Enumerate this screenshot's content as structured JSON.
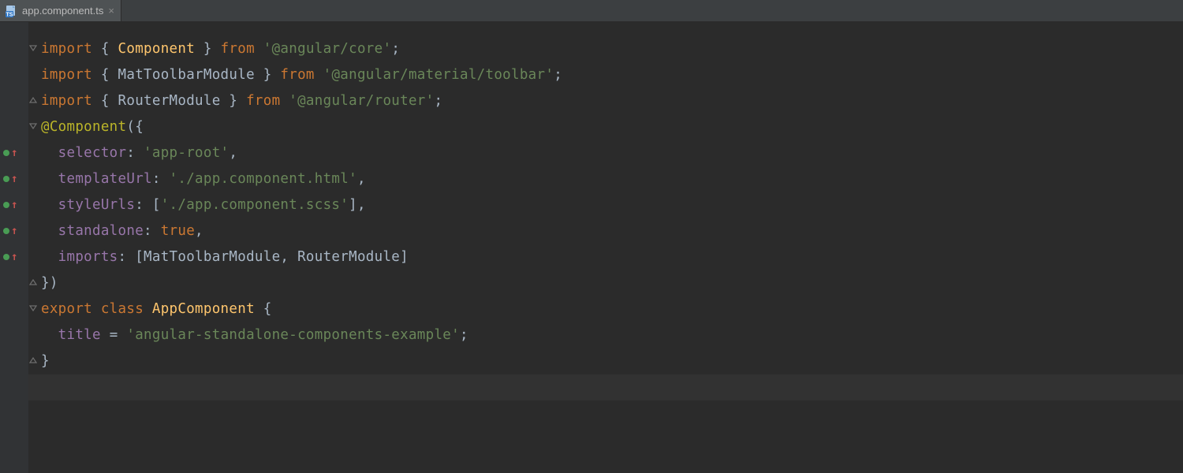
{
  "tab": {
    "filename": "app.component.ts",
    "icon": "ts-file-icon"
  },
  "code": {
    "lines": [
      {
        "fold": "open",
        "mark": null,
        "tokens": [
          [
            "kw",
            "import "
          ],
          [
            "pun",
            "{ "
          ],
          [
            "cls",
            "Component"
          ],
          [
            "pun",
            " } "
          ],
          [
            "kw",
            "from "
          ],
          [
            "str",
            "'@angular/core'"
          ],
          [
            "pun",
            ";"
          ]
        ]
      },
      {
        "fold": null,
        "mark": null,
        "tokens": [
          [
            "kw",
            "import "
          ],
          [
            "pun",
            "{ "
          ],
          [
            "plain",
            "MatToolbarModule"
          ],
          [
            "pun",
            " } "
          ],
          [
            "kw",
            "from "
          ],
          [
            "str",
            "'@angular/material/toolbar'"
          ],
          [
            "pun",
            ";"
          ]
        ]
      },
      {
        "fold": "close",
        "mark": null,
        "tokens": [
          [
            "kw",
            "import "
          ],
          [
            "pun",
            "{ "
          ],
          [
            "plain",
            "RouterModule"
          ],
          [
            "pun",
            " } "
          ],
          [
            "kw",
            "from "
          ],
          [
            "str",
            "'@angular/router'"
          ],
          [
            "pun",
            ";"
          ]
        ]
      },
      {
        "fold": "open",
        "mark": null,
        "tokens": [
          [
            "decor",
            "@Component"
          ],
          [
            "pun",
            "({"
          ]
        ]
      },
      {
        "fold": null,
        "mark": "vcs",
        "tokens": [
          [
            "plain",
            "  "
          ],
          [
            "prop",
            "selector"
          ],
          [
            "pun",
            ": "
          ],
          [
            "str",
            "'app-root'"
          ],
          [
            "pun",
            ","
          ]
        ]
      },
      {
        "fold": null,
        "mark": "vcs",
        "tokens": [
          [
            "plain",
            "  "
          ],
          [
            "prop",
            "templateUrl"
          ],
          [
            "pun",
            ": "
          ],
          [
            "str",
            "'./app.component.html'"
          ],
          [
            "pun",
            ","
          ]
        ]
      },
      {
        "fold": null,
        "mark": "vcs",
        "tokens": [
          [
            "plain",
            "  "
          ],
          [
            "prop",
            "styleUrls"
          ],
          [
            "pun",
            ": ["
          ],
          [
            "str",
            "'./app.component.scss'"
          ],
          [
            "pun",
            "],"
          ]
        ]
      },
      {
        "fold": null,
        "mark": "vcs",
        "tokens": [
          [
            "plain",
            "  "
          ],
          [
            "prop",
            "standalone"
          ],
          [
            "pun",
            ": "
          ],
          [
            "kw",
            "true"
          ],
          [
            "pun",
            ","
          ]
        ]
      },
      {
        "fold": null,
        "mark": "vcs",
        "tokens": [
          [
            "plain",
            "  "
          ],
          [
            "prop",
            "imports"
          ],
          [
            "pun",
            ": ["
          ],
          [
            "plain",
            "MatToolbarModule"
          ],
          [
            "pun",
            ", "
          ],
          [
            "plain",
            "RouterModule"
          ],
          [
            "pun",
            "]"
          ]
        ]
      },
      {
        "fold": "close",
        "mark": null,
        "tokens": [
          [
            "pun",
            "})"
          ]
        ]
      },
      {
        "fold": "open",
        "mark": null,
        "tokens": [
          [
            "kw",
            "export class "
          ],
          [
            "cls",
            "AppComponent"
          ],
          [
            "pun",
            " {"
          ]
        ]
      },
      {
        "fold": null,
        "mark": null,
        "tokens": [
          [
            "plain",
            "  "
          ],
          [
            "prop",
            "title"
          ],
          [
            "pun",
            " = "
          ],
          [
            "str",
            "'angular-standalone-components-example'"
          ],
          [
            "pun",
            ";"
          ]
        ]
      },
      {
        "fold": "close",
        "mark": null,
        "tokens": [
          [
            "pun",
            "}"
          ]
        ]
      }
    ],
    "caret_line_index": 13
  }
}
